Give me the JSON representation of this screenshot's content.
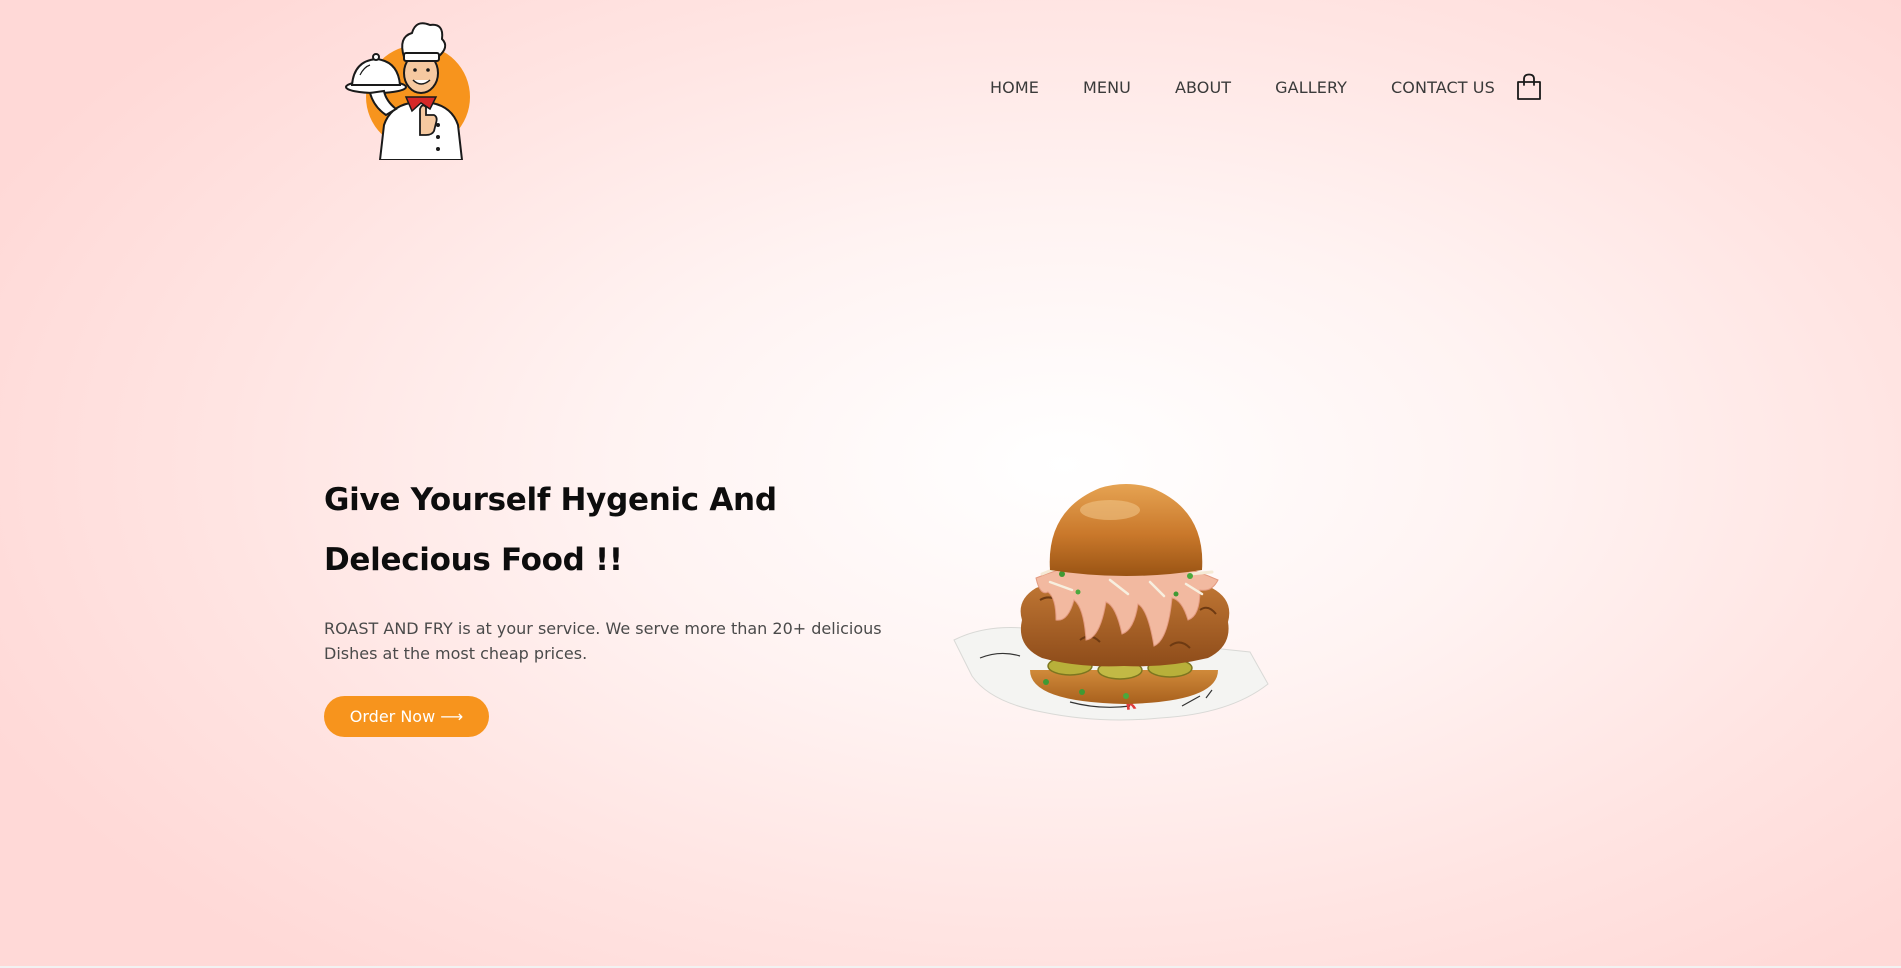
{
  "header": {
    "logo_name": "chef-logo",
    "nav": [
      {
        "label": "HOME"
      },
      {
        "label": "MENU"
      },
      {
        "label": "ABOUT"
      },
      {
        "label": "GALLERY"
      },
      {
        "label": "CONTACT US"
      }
    ],
    "cart_icon": "shopping-bag-icon"
  },
  "hero": {
    "title_line1": "Give Yourself Hygenic And",
    "title_line2": "Delecious Food !!",
    "description": "ROAST AND FRY is at your service. We serve more than 20+ delicious Dishes at the most cheap prices.",
    "cta_label": "Order Now ⟶",
    "image": "fried-chicken-burger"
  },
  "colors": {
    "accent": "#f7941d",
    "text_dark": "#0d0d0d",
    "text_body": "#4a4a4a",
    "background": "#ffe4e2"
  }
}
